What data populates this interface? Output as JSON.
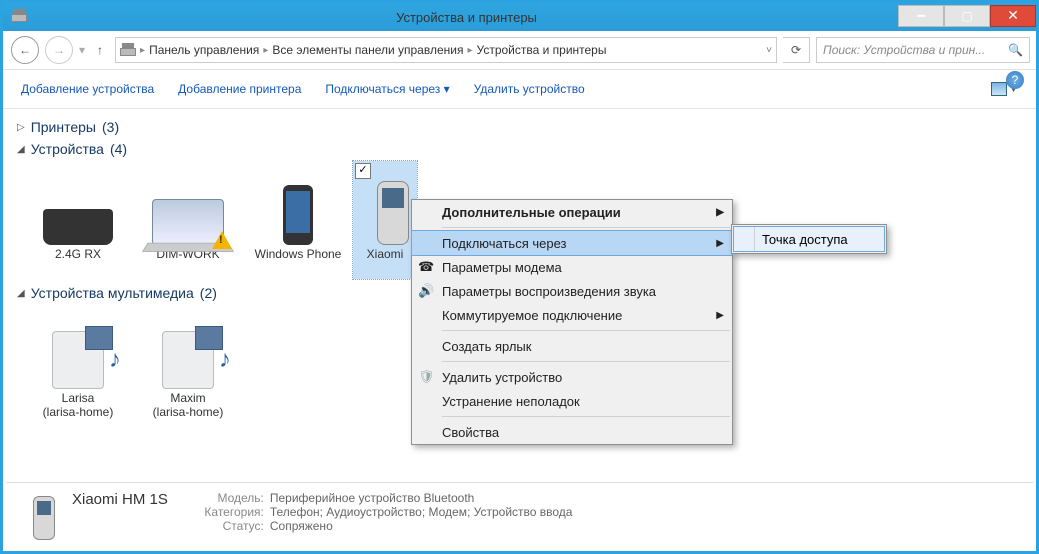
{
  "window_title": "Устройства и принтеры",
  "breadcrumb": [
    "Панель управления",
    "Все элементы панели управления",
    "Устройства и принтеры"
  ],
  "search_placeholder": "Поиск: Устройства и прин...",
  "toolbar": {
    "add_device": "Добавление устройства",
    "add_printer": "Добавление принтера",
    "connect_via": "Подключаться через",
    "remove_device": "Удалить устройство"
  },
  "groups": {
    "printers": {
      "title": "Принтеры",
      "count": "(3)",
      "collapsed": true
    },
    "devices": {
      "title": "Устройства",
      "count": "(4)",
      "items": [
        {
          "name": "2.4G RX"
        },
        {
          "name": "DIM-WORK",
          "warn": true
        },
        {
          "name": "Windows Phone"
        },
        {
          "name": "Xiaomi",
          "selected": true
        }
      ]
    },
    "multimedia": {
      "title": "Устройства мультимедиа",
      "count": "(2)",
      "items": [
        {
          "name": "Larisa",
          "sub": "(larisa-home)"
        },
        {
          "name": "Maxim",
          "sub": "(larisa-home)"
        }
      ]
    }
  },
  "context_menu": {
    "additional": "Дополнительные операции",
    "connect_via": "Подключаться через",
    "modem_params": "Параметры модема",
    "audio_params": "Параметры воспроизведения звука",
    "dialup": "Коммутируемое подключение",
    "create_shortcut": "Создать ярлык",
    "remove": "Удалить устройство",
    "troubleshoot": "Устранение неполадок",
    "properties": "Свойства",
    "submenu": {
      "access_point": "Точка доступа"
    }
  },
  "details": {
    "name": "Xiaomi HM 1S",
    "model_label": "Модель:",
    "model": "Периферийное устройство Bluetooth",
    "category_label": "Категория:",
    "category": "Телефон; Аудиоустройство; Модем; Устройство ввода",
    "status_label": "Статус:",
    "status": "Сопряжено"
  }
}
